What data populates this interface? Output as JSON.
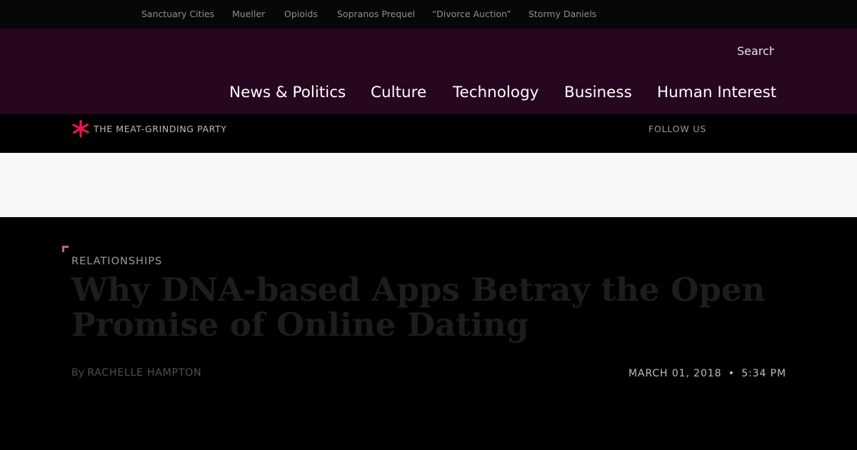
{
  "trending": [
    "Sanctuary Cities",
    "Mueller",
    "Opioids",
    "Sopranos Prequel",
    "“Divorce Auction”",
    "Stormy Daniels"
  ],
  "header": {
    "search_label": "Search",
    "nav": [
      "News & Politics",
      "Culture",
      "Technology",
      "Business",
      "Human Interest"
    ]
  },
  "subbar": {
    "promo": "THE MEAT-GRINDING PARTY",
    "follow": "FOLLOW US"
  },
  "article": {
    "kicker": "RELATIONSHIPS",
    "title": "Why DNA-based Apps Betray the Open Promise of Online Dating",
    "by": "By",
    "author": "RACHELLE HAMPTON",
    "date": "MARCH 01, 2018",
    "separator": "•",
    "time": "5:34 PM"
  },
  "colors": {
    "header_bg": "#27061f",
    "accent": "#e8174a",
    "ad_band": "#f7f7f7"
  },
  "icons": [
    "slate-logo-icon"
  ]
}
